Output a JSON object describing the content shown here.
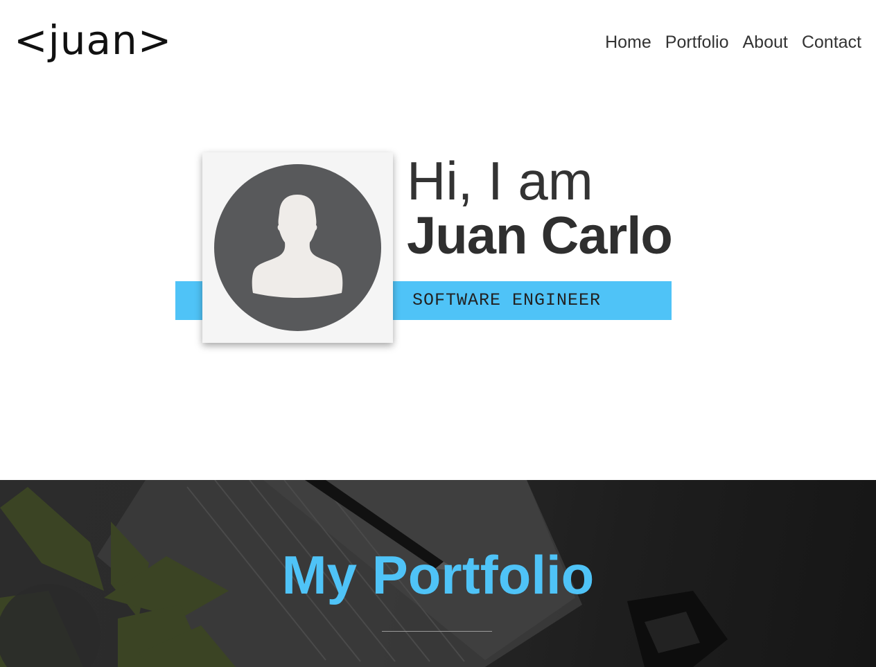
{
  "brand": {
    "logo": "<juan>"
  },
  "nav": {
    "items": [
      "Home",
      "Portfolio",
      "About",
      "Contact"
    ]
  },
  "hero": {
    "greeting": "Hi, I am",
    "name": "Juan Carlo",
    "role": "SOFTWARE ENGINEER"
  },
  "portfolio": {
    "title": "My Portfolio"
  },
  "colors": {
    "accent": "#4fc3f7",
    "dark_text": "#333333",
    "avatar_circle": "#58595b",
    "avatar_figure": "#efece9"
  },
  "icons": {
    "avatar": "user-silhouette-icon"
  }
}
